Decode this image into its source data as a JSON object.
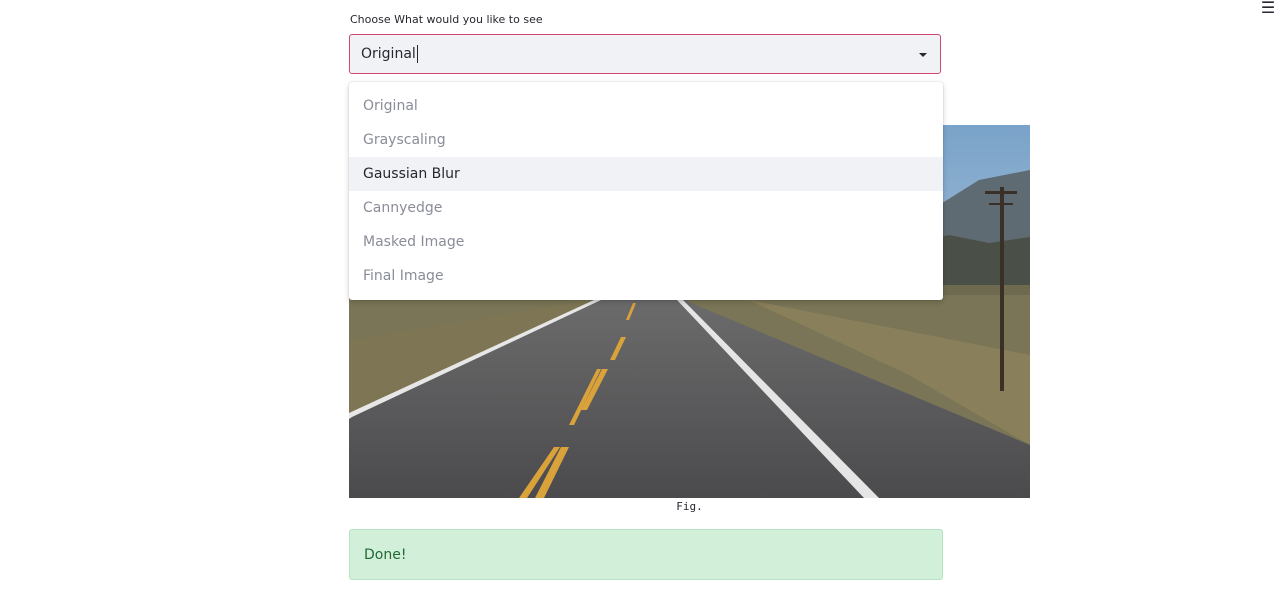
{
  "menu": {
    "icon": "hamburger-menu-icon",
    "glyph": "☰"
  },
  "select": {
    "label": "Choose What would you like to see",
    "value": "Original",
    "options": [
      {
        "label": "Original",
        "highlighted": false
      },
      {
        "label": "Grayscaling",
        "highlighted": false
      },
      {
        "label": "Gaussian Blur",
        "highlighted": true
      },
      {
        "label": "Cannyedge",
        "highlighted": false
      },
      {
        "label": "Masked Image",
        "highlighted": false
      },
      {
        "label": "Final Image",
        "highlighted": false
      }
    ]
  },
  "figure": {
    "caption": "Fig."
  },
  "status": {
    "message": "Done!"
  },
  "colors": {
    "accent": "#d44672",
    "select_bg": "#f0f2f6",
    "success_bg": "#d1efd9",
    "success_text": "#216a36"
  }
}
